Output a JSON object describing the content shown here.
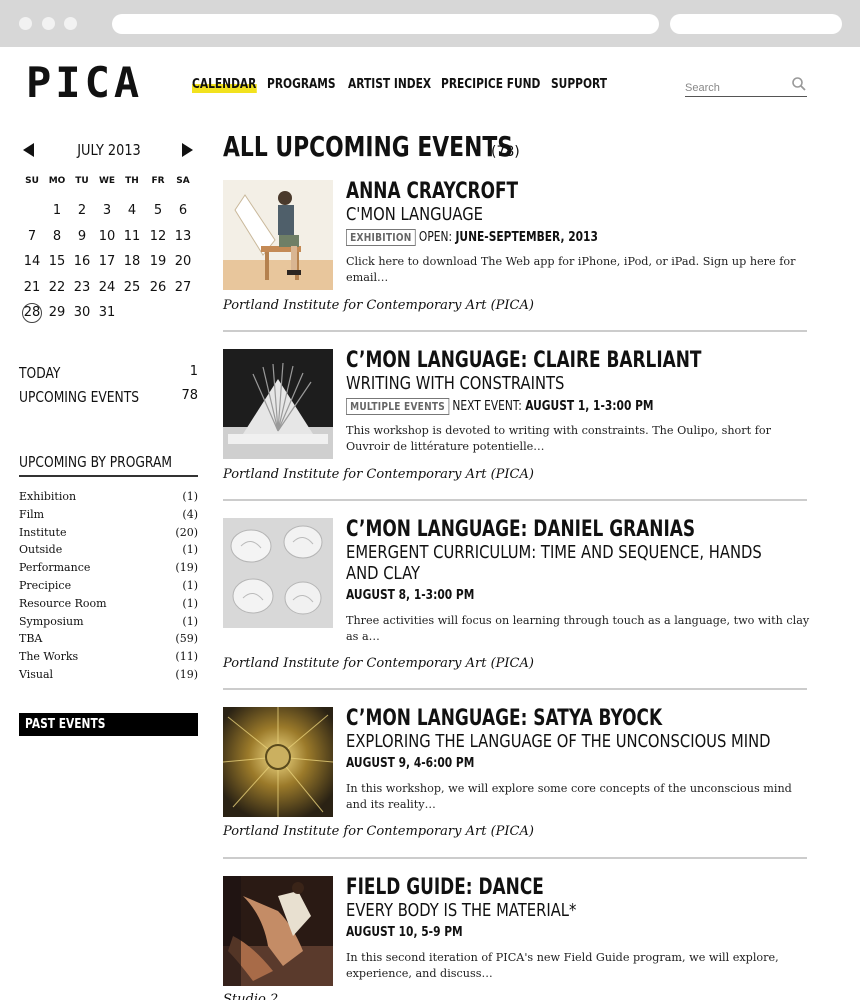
{
  "site": {
    "logo": "PICA",
    "nav": [
      {
        "label": "CALENDAR",
        "active": true
      },
      {
        "label": "PROGRAMS"
      },
      {
        "label": "ARTIST INDEX"
      },
      {
        "label": "PRECIPICE FUND"
      },
      {
        "label": "SUPPORT"
      }
    ],
    "search": {
      "placeholder": "Search",
      "icon": "search-icon"
    },
    "accent": "#f2e21e"
  },
  "calendar": {
    "month": "JULY 2013",
    "prev_icon": "triangle-left-icon",
    "next_icon": "triangle-right-icon",
    "weekdays": [
      "SU",
      "MO",
      "TU",
      "WE",
      "TH",
      "FR",
      "SA"
    ],
    "weeks": [
      [
        "",
        "1",
        "2",
        "3",
        "4",
        "5",
        "6"
      ],
      [
        "7",
        "8",
        "9",
        "10",
        "11",
        "12",
        "13"
      ],
      [
        "14",
        "15",
        "16",
        "17",
        "18",
        "19",
        "20"
      ],
      [
        "21",
        "22",
        "23",
        "24",
        "25",
        "26",
        "27"
      ],
      [
        "28",
        "29",
        "30",
        "31",
        "",
        "",
        ""
      ]
    ],
    "today": "28"
  },
  "stats": [
    {
      "label": "TODAY",
      "count": "1"
    },
    {
      "label": "UPCOMING EVENTS",
      "count": "78"
    }
  ],
  "programs": {
    "title": "UPCOMING BY PROGRAM",
    "items": [
      {
        "name": "Exhibition",
        "count": "(1)"
      },
      {
        "name": "Film",
        "count": "(4)"
      },
      {
        "name": "Institute",
        "count": "(20)"
      },
      {
        "name": "Outside",
        "count": "(1)"
      },
      {
        "name": "Performance",
        "count": "(19)"
      },
      {
        "name": "Precipice",
        "count": "(1)"
      },
      {
        "name": "Resource Room",
        "count": "(1)"
      },
      {
        "name": "Symposium",
        "count": "(1)"
      },
      {
        "name": "TBA",
        "count": "(59)"
      },
      {
        "name": "The Works",
        "count": "(11)"
      },
      {
        "name": "Visual",
        "count": "(19)"
      }
    ]
  },
  "past_events": "PAST EVENTS",
  "main": {
    "title": "ALL UPCOMING EVENTS",
    "count": "(78)"
  },
  "events": [
    {
      "title": "ANNA CRAYCROFT",
      "subtitle": "C'MON LANGUAGE",
      "badge": "EXHIBITION",
      "meta_label": "OPEN:",
      "meta_value": "JUNE-SEPTEMBER, 2013",
      "description": "Click here to download The Web app for iPhone, iPod, or iPad. Sign up here for email…",
      "venue": "Portland Institute for Contemporary Art (PICA)"
    },
    {
      "title": "C’MON LANGUAGE: CLAIRE BARLIANT",
      "subtitle": "WRITING WITH CONSTRAINTS",
      "badge": "MULTIPLE EVENTS",
      "meta_label": "NEXT EVENT:",
      "meta_value": "AUGUST 1, 1-3:00 PM",
      "description": "This workshop is devoted to writing with constraints. The Oulipo, short for Ouvroir de littérature potentielle…",
      "venue": "Portland Institute for Contemporary Art (PICA)"
    },
    {
      "title": "C’MON LANGUAGE: DANIEL GRANIAS",
      "subtitle": "EMERGENT CURRICULUM: TIME AND SEQUENCE, HANDS AND CLAY",
      "badge": "",
      "meta_label": "",
      "meta_value": "AUGUST 8, 1-3:00 PM",
      "description": "Three activities will focus on learning through touch as a language, two with clay as a…",
      "venue": "Portland Institute for Contemporary Art (PICA)"
    },
    {
      "title": "C’MON LANGUAGE: SATYA BYOCK",
      "subtitle": "EXPLORING THE LANGUAGE OF THE UNCONSCIOUS MIND",
      "badge": "",
      "meta_label": "",
      "meta_value": "AUGUST 9, 4-6:00 PM",
      "description": "In this workshop, we will explore some core concepts of the unconscious mind and its reality…",
      "venue": "Portland Institute for Contemporary Art (PICA)"
    },
    {
      "title": "FIELD GUIDE: DANCE",
      "subtitle": "EVERY BODY IS THE MATERIAL*",
      "badge": "",
      "meta_label": "",
      "meta_value": "AUGUST 10, 5-9 PM",
      "description": "In this second iteration of PICA's new Field Guide program, we will explore, experience, and discuss…",
      "venue": "Studio 2"
    }
  ]
}
